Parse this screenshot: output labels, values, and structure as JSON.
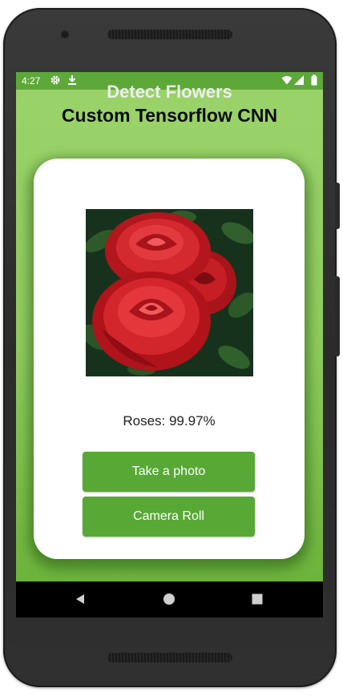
{
  "status_bar": {
    "time": "4:27",
    "icons": [
      "gear-icon",
      "download-icon",
      "wifi-icon",
      "cell-signal-icon",
      "battery-icon"
    ]
  },
  "header": {
    "title": "Detect Flowers",
    "subtitle": "Custom Tensorflow CNN"
  },
  "card": {
    "result_text": "Roses: 99.97%",
    "take_photo_label": "Take a photo",
    "camera_roll_label": "Camera Roll"
  },
  "nav_bar": {
    "icons": [
      "back-icon",
      "home-icon",
      "recents-icon"
    ]
  },
  "colors": {
    "background_gradient_top": "#9bd36b",
    "background_gradient_bottom": "#6cb33c",
    "button": "#57a835",
    "status_bar": "#5ea83a"
  }
}
